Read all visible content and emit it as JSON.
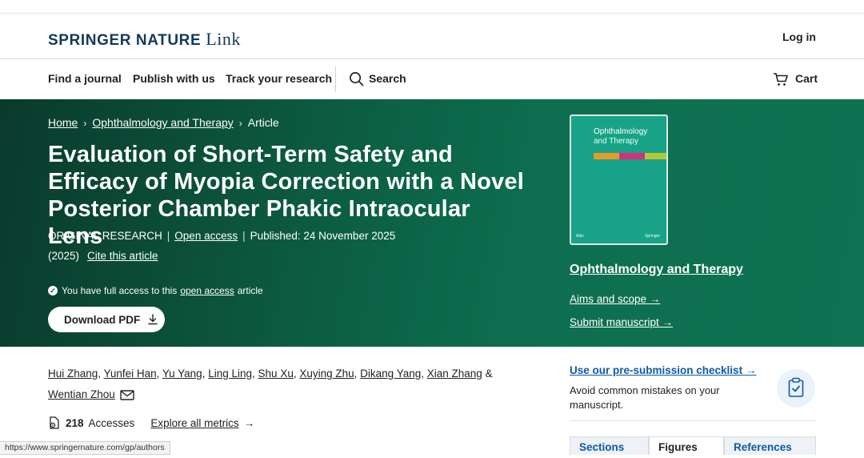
{
  "header": {
    "brand": "SPRINGER NATURE",
    "brand_suffix": "Link",
    "login": "Log in"
  },
  "nav": {
    "items": [
      "Find a journal",
      "Publish with us",
      "Track your research"
    ],
    "search": "Search",
    "cart": "Cart"
  },
  "breadcrumb": {
    "home": "Home",
    "journal": "Ophthalmology and Therapy",
    "current": "Article"
  },
  "article": {
    "title": "Evaluation of Short-Term Safety and Efficacy of Myopia Correction with a Novel Posterior Chamber Phakic Intraocular Lens",
    "type": "ORIGINAL RESEARCH",
    "open_access": "Open access",
    "published": "Published: 24 November 2025",
    "year": "(2025)",
    "cite": "Cite this article",
    "access_prefix": "You have full access to this",
    "access_link": "open access",
    "access_suffix": "article",
    "download": "Download PDF"
  },
  "journal": {
    "name": "Ophthalmology and Therapy",
    "cover_title_1": "Ophthalmology",
    "cover_title_2": "and Therapy",
    "cover_publisher_left": "Adis",
    "cover_publisher_right": "Springer",
    "aims": "Aims and scope",
    "submit": "Submit manuscript"
  },
  "authors": [
    "Hui Zhang",
    "Yunfei Han",
    "Yu Yang",
    "Ling Ling",
    "Shu Xu",
    "Xuying Zhu",
    "Dikang Yang",
    "Xian Zhang",
    "Wentian Zhou"
  ],
  "metrics": {
    "count": "218",
    "label": "Accesses",
    "explore": "Explore all metrics"
  },
  "sidebar": {
    "checklist_link": "Use our pre-submission checklist",
    "checklist_text": "Avoid common mistakes on your manuscript.",
    "tabs": [
      "Sections",
      "Figures",
      "References"
    ],
    "active_tab": "Figures"
  },
  "status_url": "https://www.springernature.com/gp/authors",
  "colors": {
    "hero_dark": "#0a3a2c",
    "hero_light": "#0e7352",
    "brand_navy": "#123a5a",
    "link_blue": "#0d5aa7",
    "cover_teal": "#18a388"
  }
}
